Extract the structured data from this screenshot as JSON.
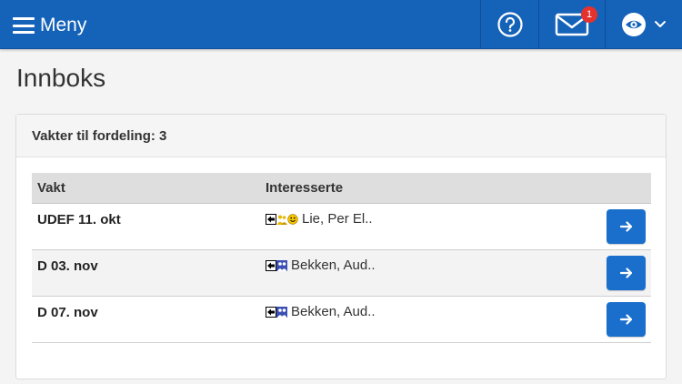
{
  "topbar": {
    "menu_label": "Meny",
    "help_icon": "help-circle-icon",
    "mail_icon": "envelope-icon",
    "mail_badge": "1",
    "view_icon": "eye-icon",
    "accent_color": "#1562b9",
    "badge_color": "#e5322d"
  },
  "page": {
    "title": "Innboks"
  },
  "panel": {
    "header": "Vakter til fordeling: 3",
    "columns": {
      "vakt": "Vakt",
      "interesserte": "Interesserte"
    },
    "rows": [
      {
        "vakt": "UDEF 11. okt",
        "icons": [
          "arrow-left-box-icon",
          "people-yellow-icon",
          "smiley-icon"
        ],
        "interesserte": "Lie, Per El..",
        "action_icon": "arrow-right-icon"
      },
      {
        "vakt": "D 03. nov",
        "icons": [
          "arrow-left-box-icon",
          "people-blue-icon"
        ],
        "interesserte": "Bekken, Aud..",
        "action_icon": "arrow-right-icon"
      },
      {
        "vakt": "D 07. nov",
        "icons": [
          "arrow-left-box-icon",
          "people-blue-icon"
        ],
        "interesserte": "Bekken, Aud..",
        "action_icon": "arrow-right-icon"
      }
    ]
  }
}
